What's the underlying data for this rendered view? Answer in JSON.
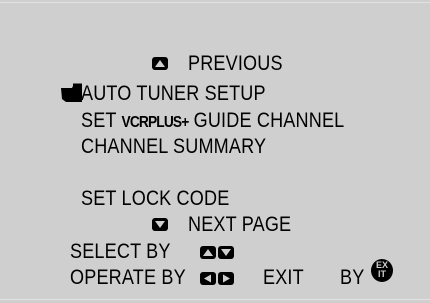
{
  "menu": {
    "previous_label": "PREVIOUS",
    "items": [
      {
        "label": "AUTO TUNER SETUP",
        "selected": true
      },
      {
        "label": "SET",
        "label_brand": "VCRPLUS+",
        "label_rest": "GUIDE CHANNEL"
      },
      {
        "label": "CHANNEL SUMMARY"
      },
      {
        "label": "SET LOCK CODE"
      }
    ],
    "next_page_label": "NEXT PAGE"
  },
  "footer": {
    "select_label": "SELECT BY",
    "operate_label": "OPERATE BY",
    "exit_label": "EXIT",
    "by_label": "BY",
    "exit_icon_top": "EX",
    "exit_icon_bottom": "IT"
  },
  "icons": {
    "up_button": "up-arrow-button-icon",
    "down_button": "down-arrow-button-icon",
    "left_button": "left-arrow-button-icon",
    "right_button": "right-arrow-button-icon",
    "pointer": "hand-pointer-icon",
    "exit_button": "exit-button-icon"
  },
  "colors": {
    "background": "#cfcfcf",
    "text": "#000000"
  }
}
